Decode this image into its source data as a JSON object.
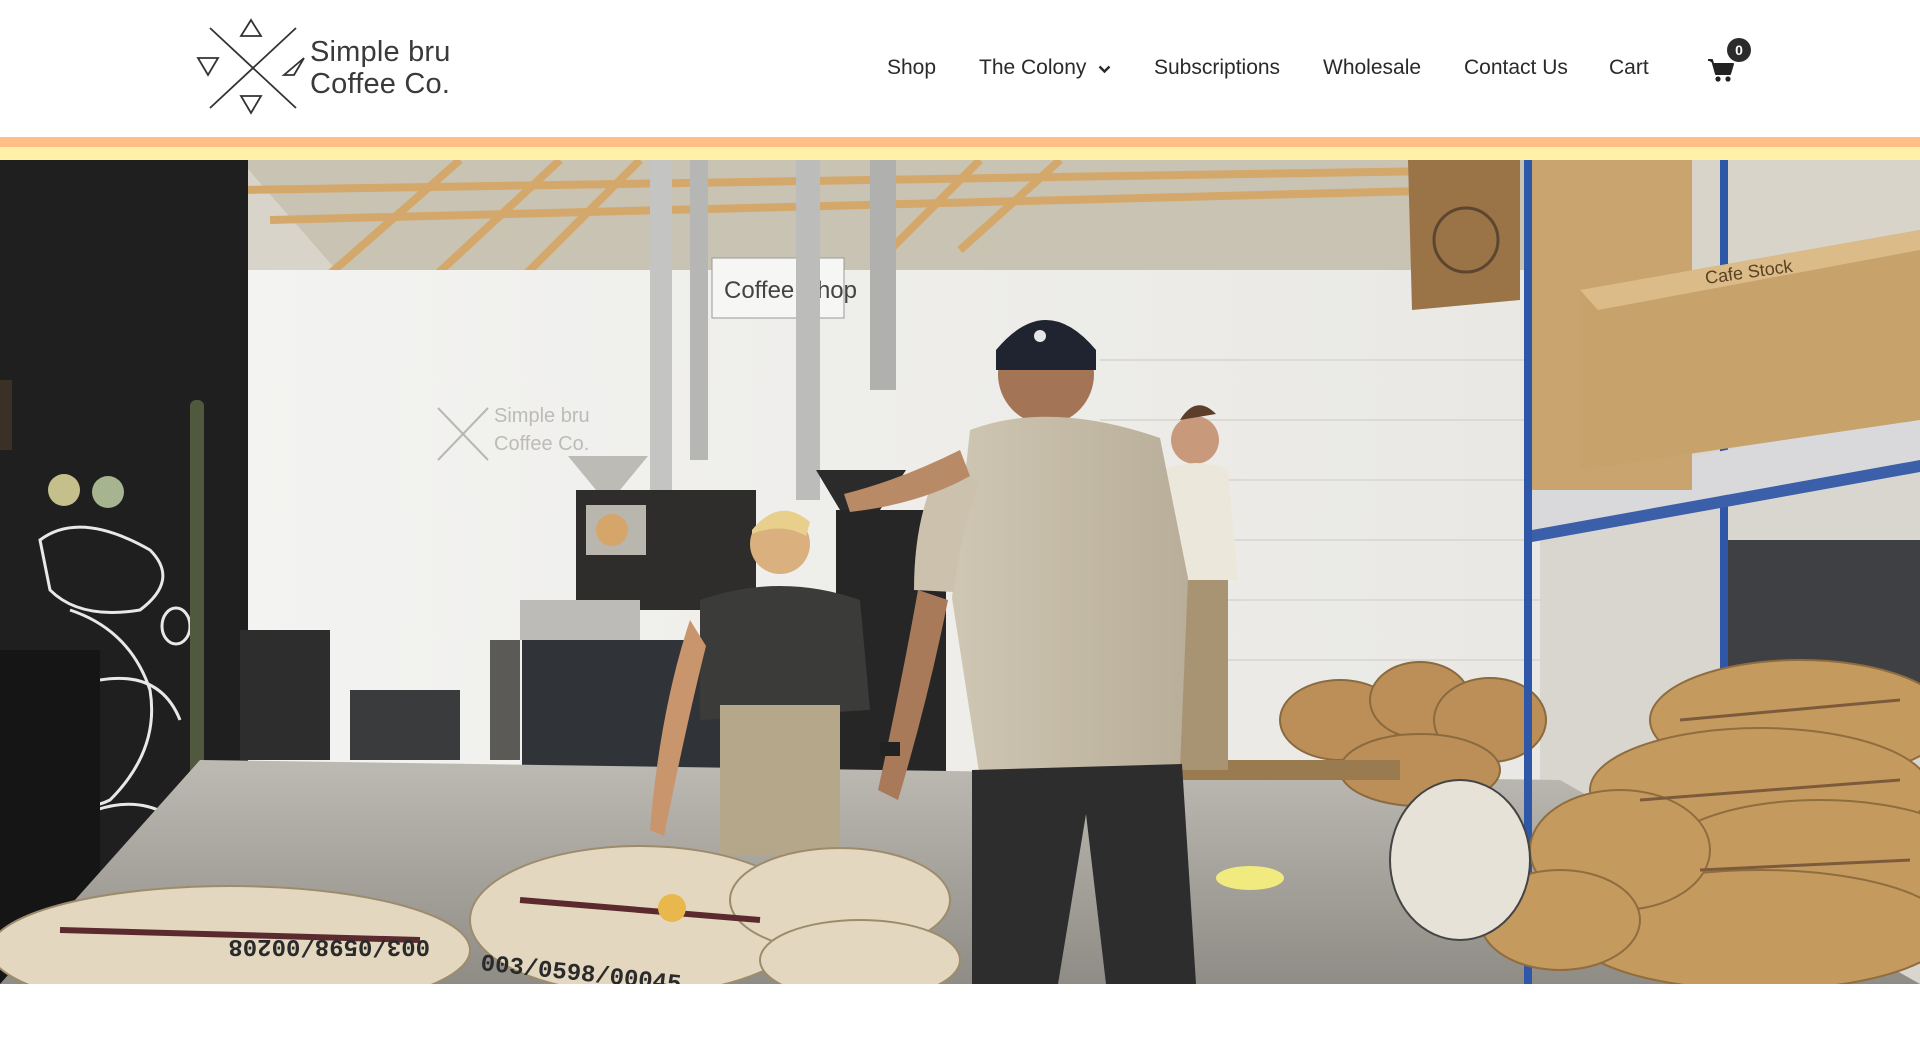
{
  "brand": {
    "name_line1": "Simple bru",
    "name_line2": "Coffee Co."
  },
  "nav": {
    "shop": "Shop",
    "colony": "The Colony",
    "subscriptions": "Subscriptions",
    "wholesale": "Wholesale",
    "contact": "Contact Us",
    "cart": "Cart",
    "cart_count": "0"
  },
  "icons": {
    "logo": "triangles-cross-logo-icon",
    "dropdown": "chevron-down-icon",
    "cart": "shopping-cart-icon"
  },
  "colors": {
    "stripe_orange": "#ffbf86",
    "stripe_yellow": "#fff1a8",
    "badge": "#2b2b2b"
  },
  "hero": {
    "description_image": "coffee-roastery-warehouse-photo",
    "sign_text": "Coffee Shop",
    "wall_logo_line1": "Simple bru",
    "wall_logo_line2": "Coffee Co.",
    "box_label": "Cafe Stock",
    "sack_number_1": "003/0598/00045",
    "sack_number_2": "003/0598/00208"
  }
}
